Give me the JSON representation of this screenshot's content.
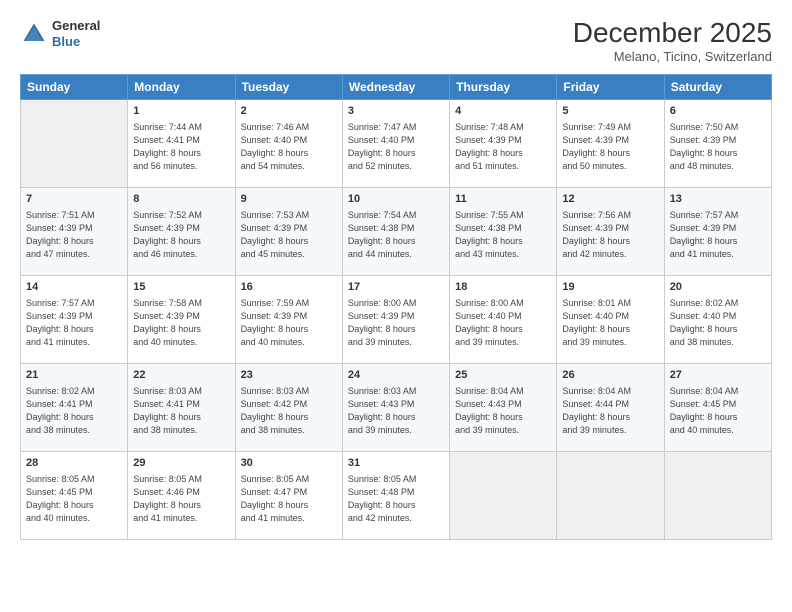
{
  "header": {
    "logo_general": "General",
    "logo_blue": "Blue",
    "month": "December 2025",
    "location": "Melano, Ticino, Switzerland"
  },
  "days_of_week": [
    "Sunday",
    "Monday",
    "Tuesday",
    "Wednesday",
    "Thursday",
    "Friday",
    "Saturday"
  ],
  "weeks": [
    [
      {
        "day": "",
        "sunrise": "",
        "sunset": "",
        "daylight": ""
      },
      {
        "day": "1",
        "sunrise": "Sunrise: 7:44 AM",
        "sunset": "Sunset: 4:41 PM",
        "daylight": "Daylight: 8 hours and 56 minutes."
      },
      {
        "day": "2",
        "sunrise": "Sunrise: 7:46 AM",
        "sunset": "Sunset: 4:40 PM",
        "daylight": "Daylight: 8 hours and 54 minutes."
      },
      {
        "day": "3",
        "sunrise": "Sunrise: 7:47 AM",
        "sunset": "Sunset: 4:40 PM",
        "daylight": "Daylight: 8 hours and 52 minutes."
      },
      {
        "day": "4",
        "sunrise": "Sunrise: 7:48 AM",
        "sunset": "Sunset: 4:39 PM",
        "daylight": "Daylight: 8 hours and 51 minutes."
      },
      {
        "day": "5",
        "sunrise": "Sunrise: 7:49 AM",
        "sunset": "Sunset: 4:39 PM",
        "daylight": "Daylight: 8 hours and 50 minutes."
      },
      {
        "day": "6",
        "sunrise": "Sunrise: 7:50 AM",
        "sunset": "Sunset: 4:39 PM",
        "daylight": "Daylight: 8 hours and 48 minutes."
      }
    ],
    [
      {
        "day": "7",
        "sunrise": "Sunrise: 7:51 AM",
        "sunset": "Sunset: 4:39 PM",
        "daylight": "Daylight: 8 hours and 47 minutes."
      },
      {
        "day": "8",
        "sunrise": "Sunrise: 7:52 AM",
        "sunset": "Sunset: 4:39 PM",
        "daylight": "Daylight: 8 hours and 46 minutes."
      },
      {
        "day": "9",
        "sunrise": "Sunrise: 7:53 AM",
        "sunset": "Sunset: 4:39 PM",
        "daylight": "Daylight: 8 hours and 45 minutes."
      },
      {
        "day": "10",
        "sunrise": "Sunrise: 7:54 AM",
        "sunset": "Sunset: 4:38 PM",
        "daylight": "Daylight: 8 hours and 44 minutes."
      },
      {
        "day": "11",
        "sunrise": "Sunrise: 7:55 AM",
        "sunset": "Sunset: 4:38 PM",
        "daylight": "Daylight: 8 hours and 43 minutes."
      },
      {
        "day": "12",
        "sunrise": "Sunrise: 7:56 AM",
        "sunset": "Sunset: 4:39 PM",
        "daylight": "Daylight: 8 hours and 42 minutes."
      },
      {
        "day": "13",
        "sunrise": "Sunrise: 7:57 AM",
        "sunset": "Sunset: 4:39 PM",
        "daylight": "Daylight: 8 hours and 41 minutes."
      }
    ],
    [
      {
        "day": "14",
        "sunrise": "Sunrise: 7:57 AM",
        "sunset": "Sunset: 4:39 PM",
        "daylight": "Daylight: 8 hours and 41 minutes."
      },
      {
        "day": "15",
        "sunrise": "Sunrise: 7:58 AM",
        "sunset": "Sunset: 4:39 PM",
        "daylight": "Daylight: 8 hours and 40 minutes."
      },
      {
        "day": "16",
        "sunrise": "Sunrise: 7:59 AM",
        "sunset": "Sunset: 4:39 PM",
        "daylight": "Daylight: 8 hours and 40 minutes."
      },
      {
        "day": "17",
        "sunrise": "Sunrise: 8:00 AM",
        "sunset": "Sunset: 4:39 PM",
        "daylight": "Daylight: 8 hours and 39 minutes."
      },
      {
        "day": "18",
        "sunrise": "Sunrise: 8:00 AM",
        "sunset": "Sunset: 4:40 PM",
        "daylight": "Daylight: 8 hours and 39 minutes."
      },
      {
        "day": "19",
        "sunrise": "Sunrise: 8:01 AM",
        "sunset": "Sunset: 4:40 PM",
        "daylight": "Daylight: 8 hours and 39 minutes."
      },
      {
        "day": "20",
        "sunrise": "Sunrise: 8:02 AM",
        "sunset": "Sunset: 4:40 PM",
        "daylight": "Daylight: 8 hours and 38 minutes."
      }
    ],
    [
      {
        "day": "21",
        "sunrise": "Sunrise: 8:02 AM",
        "sunset": "Sunset: 4:41 PM",
        "daylight": "Daylight: 8 hours and 38 minutes."
      },
      {
        "day": "22",
        "sunrise": "Sunrise: 8:03 AM",
        "sunset": "Sunset: 4:41 PM",
        "daylight": "Daylight: 8 hours and 38 minutes."
      },
      {
        "day": "23",
        "sunrise": "Sunrise: 8:03 AM",
        "sunset": "Sunset: 4:42 PM",
        "daylight": "Daylight: 8 hours and 38 minutes."
      },
      {
        "day": "24",
        "sunrise": "Sunrise: 8:03 AM",
        "sunset": "Sunset: 4:43 PM",
        "daylight": "Daylight: 8 hours and 39 minutes."
      },
      {
        "day": "25",
        "sunrise": "Sunrise: 8:04 AM",
        "sunset": "Sunset: 4:43 PM",
        "daylight": "Daylight: 8 hours and 39 minutes."
      },
      {
        "day": "26",
        "sunrise": "Sunrise: 8:04 AM",
        "sunset": "Sunset: 4:44 PM",
        "daylight": "Daylight: 8 hours and 39 minutes."
      },
      {
        "day": "27",
        "sunrise": "Sunrise: 8:04 AM",
        "sunset": "Sunset: 4:45 PM",
        "daylight": "Daylight: 8 hours and 40 minutes."
      }
    ],
    [
      {
        "day": "28",
        "sunrise": "Sunrise: 8:05 AM",
        "sunset": "Sunset: 4:45 PM",
        "daylight": "Daylight: 8 hours and 40 minutes."
      },
      {
        "day": "29",
        "sunrise": "Sunrise: 8:05 AM",
        "sunset": "Sunset: 4:46 PM",
        "daylight": "Daylight: 8 hours and 41 minutes."
      },
      {
        "day": "30",
        "sunrise": "Sunrise: 8:05 AM",
        "sunset": "Sunset: 4:47 PM",
        "daylight": "Daylight: 8 hours and 41 minutes."
      },
      {
        "day": "31",
        "sunrise": "Sunrise: 8:05 AM",
        "sunset": "Sunset: 4:48 PM",
        "daylight": "Daylight: 8 hours and 42 minutes."
      },
      {
        "day": "",
        "sunrise": "",
        "sunset": "",
        "daylight": ""
      },
      {
        "day": "",
        "sunrise": "",
        "sunset": "",
        "daylight": ""
      },
      {
        "day": "",
        "sunrise": "",
        "sunset": "",
        "daylight": ""
      }
    ]
  ]
}
